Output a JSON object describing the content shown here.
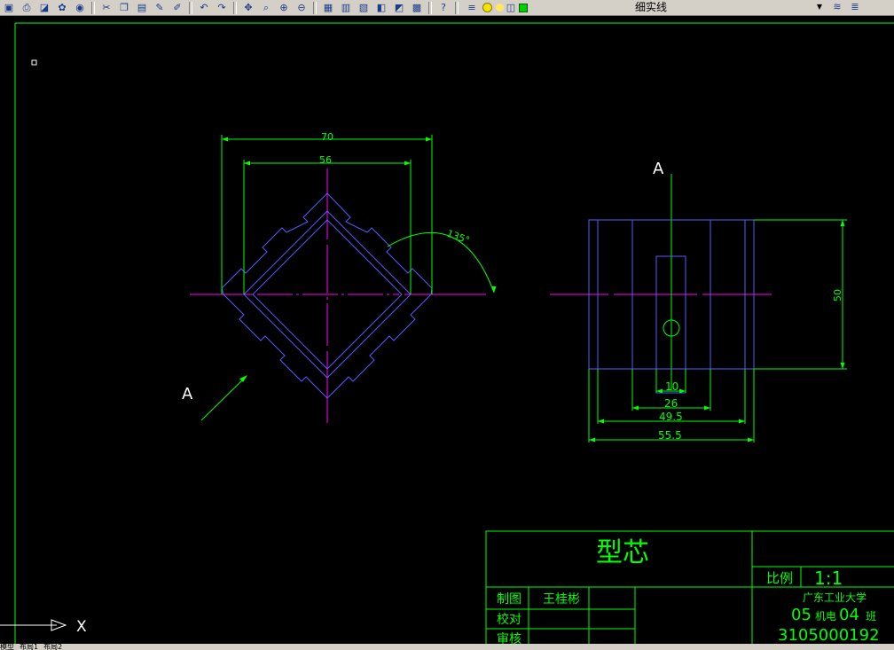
{
  "toolbar": {
    "buttons": [
      {
        "name": "save-icon",
        "glyph": "▣"
      },
      {
        "name": "print-icon",
        "glyph": "⎙"
      },
      {
        "name": "preview-icon",
        "glyph": "◪"
      },
      {
        "name": "publish-icon",
        "glyph": "✿"
      },
      {
        "name": "plot-icon",
        "glyph": "◉"
      },
      {
        "name": "cut-icon",
        "glyph": "✂"
      },
      {
        "name": "copy-icon",
        "glyph": "❐"
      },
      {
        "name": "paste-icon",
        "glyph": "▤"
      },
      {
        "name": "matchprop-icon",
        "glyph": "✎"
      },
      {
        "name": "block-editor-icon",
        "glyph": "✐"
      },
      {
        "name": "undo-icon",
        "glyph": "↶"
      },
      {
        "name": "redo-icon",
        "glyph": "↷"
      },
      {
        "name": "pan-icon",
        "glyph": "✥"
      },
      {
        "name": "zoom-realtime-icon",
        "glyph": "⌕"
      },
      {
        "name": "zoom-window-icon",
        "glyph": "⊕"
      },
      {
        "name": "zoom-previous-icon",
        "glyph": "⊖"
      },
      {
        "name": "properties-icon",
        "glyph": "▦"
      },
      {
        "name": "design-center-icon",
        "glyph": "▥"
      },
      {
        "name": "tool-palettes-icon",
        "glyph": "▧"
      },
      {
        "name": "sheet-set-icon",
        "glyph": "◧"
      },
      {
        "name": "markup-icon",
        "glyph": "◩"
      },
      {
        "name": "calculator-icon",
        "glyph": "▩"
      },
      {
        "name": "help-icon",
        "glyph": "?"
      }
    ],
    "linetype_value": "细实线",
    "right_buttons": [
      {
        "name": "layer-previous-icon",
        "glyph": "≋"
      },
      {
        "name": "layer-states-icon",
        "glyph": "≣"
      }
    ]
  },
  "drawing": {
    "dims": {
      "outer_width": "70",
      "inner_width": "56",
      "angle": "135°",
      "height_50": "50",
      "hole_10": "10",
      "dim_26": "26",
      "dim_49_5": "49.5",
      "dim_55_5": "55.5"
    },
    "section_label": "A",
    "section_label_left": "A",
    "ucs_x": "X"
  },
  "title_block": {
    "part_name": "型芯",
    "scale_label": "比例",
    "scale_value": "1:1",
    "drawn_label": "制图",
    "drawn_name": "王桂彬",
    "check_label": "校对",
    "approve_label": "审核",
    "school": "广东工业大学",
    "class_prefix": "05",
    "class_mid": "机电",
    "class_num": "04",
    "class_suffix": "班",
    "student_id": "3105000192"
  },
  "status_tabs": [
    "模型",
    "布局1",
    "布局2"
  ],
  "colors": {
    "frame": "#00ff00",
    "geometry": "#5a5aff",
    "dims": "#00ff00",
    "center": "#ff00ff",
    "white": "#ffffff",
    "canvas_bg": "#000000"
  }
}
